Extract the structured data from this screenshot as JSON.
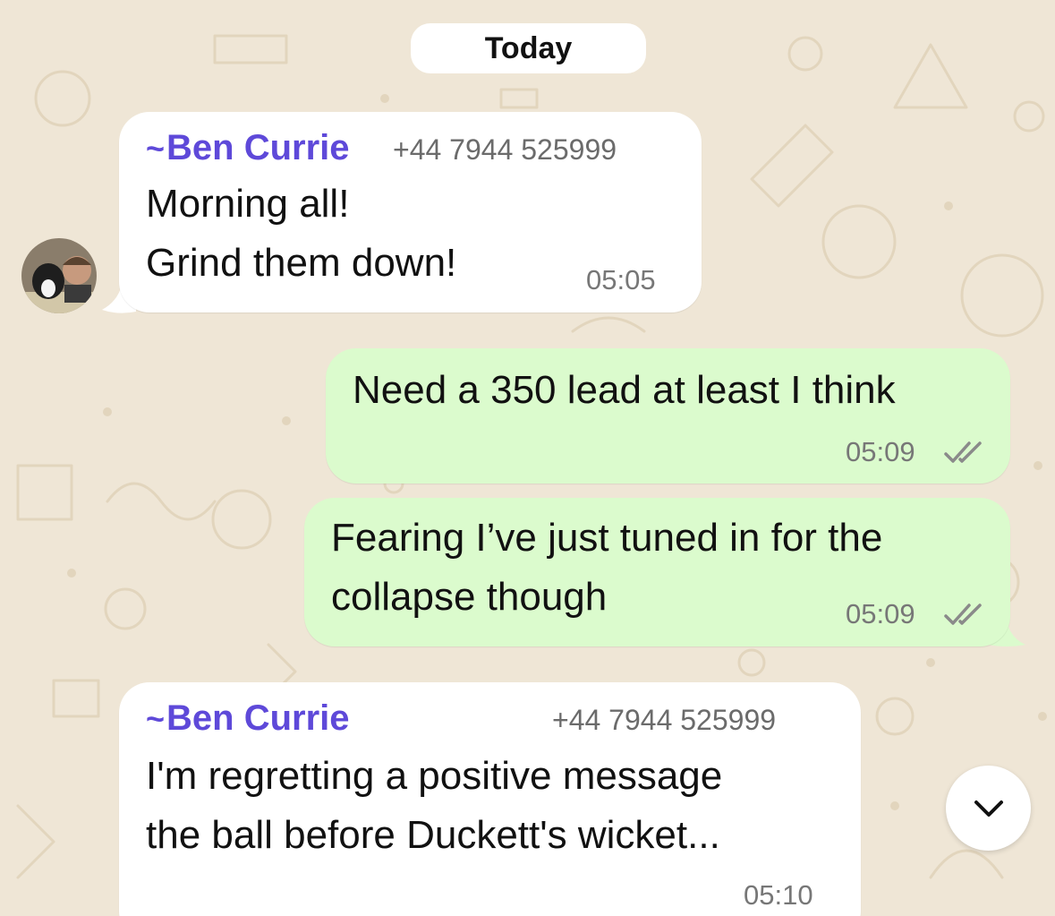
{
  "date_separator": "Today",
  "messages": [
    {
      "direction": "incoming",
      "sender_prefix": "~",
      "sender_name": "Ben Currie",
      "sender_phone": "+44 7944 525999",
      "lines": [
        "Morning all!",
        "Grind them down!"
      ],
      "time": "05:05"
    },
    {
      "direction": "outgoing",
      "lines": [
        "Need a 350 lead at least I think"
      ],
      "time": "05:09",
      "status": "read"
    },
    {
      "direction": "outgoing",
      "lines": [
        "Fearing I’ve just tuned in for the",
        "collapse though"
      ],
      "time": "05:09",
      "status": "read"
    },
    {
      "direction": "incoming",
      "sender_prefix": "~",
      "sender_name": "Ben Currie",
      "sender_phone": "+44 7944 525999",
      "lines": [
        "I'm regretting a positive message",
        "the ball before Duckett's wicket..."
      ],
      "time": "05:10"
    }
  ],
  "icons": {
    "read_ticks": "double-check-icon",
    "scroll_down": "chevron-down-icon",
    "avatar": "sender-avatar"
  },
  "colors": {
    "background": "#efe6d6",
    "incoming_bubble": "#ffffff",
    "outgoing_bubble": "#dbfbcd",
    "sender_name": "#5e49d9",
    "read_ticks": "#8a8a8a"
  }
}
